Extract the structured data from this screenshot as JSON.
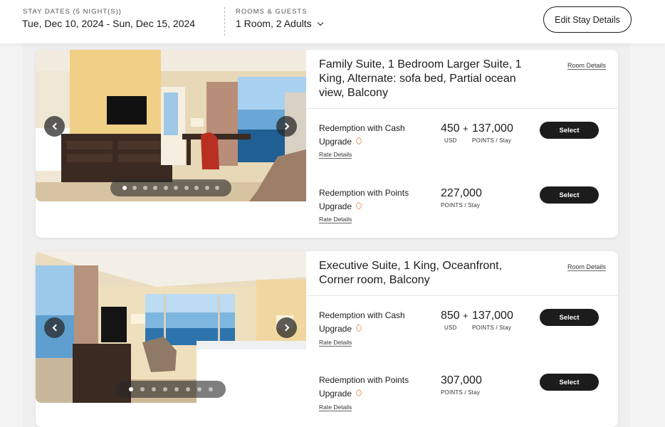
{
  "header": {
    "stay_dates_label": "STAY DATES (5 NIGHT(S))",
    "stay_dates_value": "Tue, Dec 10, 2024 - Sun, Dec 15, 2024",
    "rooms_label": "ROOMS & GUESTS",
    "rooms_value": "1 Room, 2 Adults",
    "edit_button": "Edit Stay Details"
  },
  "rooms": [
    {
      "title": "Family Suite, 1 Bedroom Larger Suite, 1 King, Alternate: sofa bed, Partial ocean view, Balcony",
      "room_details_link": "Room Details",
      "image_dots": 10,
      "rates": [
        {
          "name": "Redemption with Cash",
          "upgrade": "Upgrade",
          "rate_details": "Rate Details",
          "cash_amount": "450",
          "cash_unit": "USD",
          "plus": "+",
          "points_amount": "137,000",
          "points_unit": "POINTS / Stay",
          "select": "Select"
        },
        {
          "name": "Redemption with Points",
          "upgrade": "Upgrade",
          "rate_details": "Rate Details",
          "points_amount": "227,000",
          "points_unit": "POINTS / Stay",
          "select": "Select"
        }
      ]
    },
    {
      "title": "Executive Suite, 1 King, Oceanfront, Corner room, Balcony",
      "room_details_link": "Room Details",
      "image_dots": 8,
      "rates": [
        {
          "name": "Redemption with Cash",
          "upgrade": "Upgrade",
          "rate_details": "Rate Details",
          "cash_amount": "850",
          "cash_unit": "USD",
          "plus": "+",
          "points_amount": "137,000",
          "points_unit": "POINTS / Stay",
          "select": "Select"
        },
        {
          "name": "Redemption with Points",
          "upgrade": "Upgrade",
          "rate_details": "Rate Details",
          "points_amount": "307,000",
          "points_unit": "POINTS / Stay",
          "select": "Select"
        }
      ]
    }
  ],
  "colors": {
    "primary_dark": "#1c1c1c",
    "upgrade_tag": "#e8a27a",
    "page_bg": "#f4f4f4"
  }
}
